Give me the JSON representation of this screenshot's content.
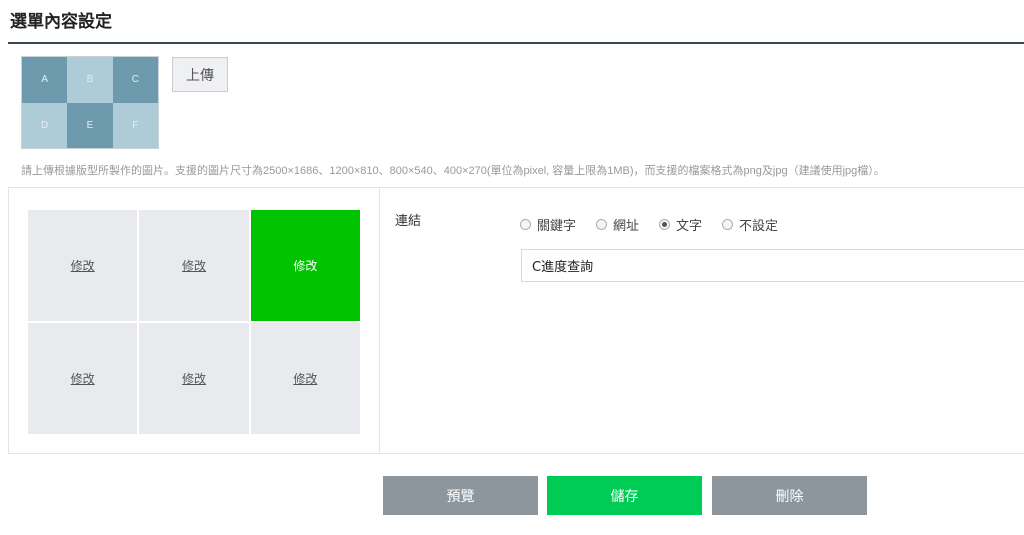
{
  "page": {
    "title": "選單內容設定"
  },
  "image": {
    "thumb_cells": [
      "A",
      "B",
      "C",
      "D",
      "E",
      "F"
    ],
    "upload_label": "上傳",
    "hint": "請上傳根據版型所製作的圖片。支援的圖片尺寸為2500×1686、1200×810、800×540、400×270(單位為pixel, 容量上限為1MB)，而支援的檔案格式為png及jpg（建議使用jpg檔）。"
  },
  "blocks": [
    {
      "label": "修改",
      "active": false
    },
    {
      "label": "修改",
      "active": false
    },
    {
      "label": "修改",
      "active": true
    },
    {
      "label": "修改",
      "active": false
    },
    {
      "label": "修改",
      "active": false
    },
    {
      "label": "修改",
      "active": false
    }
  ],
  "link": {
    "label": "連結",
    "options": [
      {
        "label": "關鍵字",
        "checked": false
      },
      {
        "label": "網址",
        "checked": false
      },
      {
        "label": "文字",
        "checked": true
      },
      {
        "label": "不設定",
        "checked": false
      }
    ],
    "text_value": "C進度查詢"
  },
  "actions": {
    "preview": "預覽",
    "save": "儲存",
    "delete": "刪除"
  },
  "colors": {
    "active_block": "#00c300",
    "save_button": "#00cc55",
    "neutral_button": "#8e969d"
  }
}
